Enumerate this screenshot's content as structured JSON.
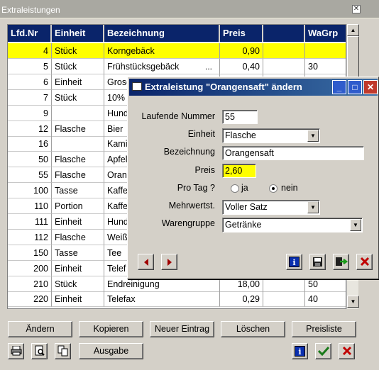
{
  "window": {
    "title": "Extraleistungen",
    "close_glyph": "✕"
  },
  "table": {
    "columns": [
      "Lfd.Nr",
      "Einheit",
      "Bezeichnung",
      "Preis",
      "",
      "WaGrp"
    ],
    "rows": [
      {
        "nr": "4",
        "einheit": "Stück",
        "bez": "Korngebäck",
        "preis": "0,90",
        "x": "",
        "wagrp": ""
      },
      {
        "nr": "5",
        "einheit": "Stück",
        "bez": "Frühstücksgebäck",
        "preis": "0,40",
        "x": "",
        "wagrp": "30",
        "ellipsis": "..."
      },
      {
        "nr": "6",
        "einheit": "Einheit",
        "bez": "Grosс",
        "preis": "",
        "x": "",
        "wagrp": ""
      },
      {
        "nr": "7",
        "einheit": "Stück",
        "bez": "10%",
        "preis": "",
        "x": "",
        "wagrp": ""
      },
      {
        "nr": "9",
        "einheit": "",
        "bez": "Hund",
        "preis": "",
        "x": "",
        "wagrp": ""
      },
      {
        "nr": "12",
        "einheit": "Flasche",
        "bez": "Bier",
        "preis": "",
        "x": "",
        "wagrp": ""
      },
      {
        "nr": "16",
        "einheit": "",
        "bez": "Kami",
        "preis": "",
        "x": "",
        "wagrp": ""
      },
      {
        "nr": "50",
        "einheit": "Flasche",
        "bez": "Apfel",
        "preis": "",
        "x": "",
        "wagrp": ""
      },
      {
        "nr": "55",
        "einheit": "Flasche",
        "bez": "Orang",
        "preis": "",
        "x": "",
        "wagrp": ""
      },
      {
        "nr": "100",
        "einheit": "Tasse",
        "bez": "Kaffe",
        "preis": "",
        "x": "",
        "wagrp": ""
      },
      {
        "nr": "110",
        "einheit": "Portion",
        "bez": "Kaffe",
        "preis": "",
        "x": "",
        "wagrp": ""
      },
      {
        "nr": "111",
        "einheit": "Einheit",
        "bez": "Hund",
        "preis": "",
        "x": "",
        "wagrp": ""
      },
      {
        "nr": "112",
        "einheit": "Flasche",
        "bez": "Weiß",
        "preis": "",
        "x": "",
        "wagrp": ""
      },
      {
        "nr": "150",
        "einheit": "Tasse",
        "bez": "Tee",
        "preis": "",
        "x": "",
        "wagrp": ""
      },
      {
        "nr": "200",
        "einheit": "Einheit",
        "bez": "Telef",
        "preis": "",
        "x": "",
        "wagrp": ""
      },
      {
        "nr": "210",
        "einheit": "Stück",
        "bez": "Endreinigung",
        "preis": "18,00",
        "x": "",
        "wagrp": "50"
      },
      {
        "nr": "220",
        "einheit": "Einheit",
        "bez": "Telefax",
        "preis": "0,29",
        "x": "",
        "wagrp": "40"
      }
    ]
  },
  "buttons": {
    "aendern": "Ändern",
    "kopieren": "Kopieren",
    "neuer_eintrag": "Neuer Eintrag",
    "loeschen": "Löschen",
    "preisliste": "Preisliste",
    "ausgabe": "Ausgabe"
  },
  "dialog": {
    "title": "Extraleistung \"Orangensaft\" ändern",
    "labels": {
      "lfd_nr": "Laufende Nummer",
      "einheit": "Einheit",
      "bezeichnung": "Bezeichnung",
      "preis": "Preis",
      "pro_tag": "Pro Tag ?",
      "mwst": "Mehrwertst.",
      "warengruppe": "Warengruppe"
    },
    "values": {
      "lfd_nr": "55",
      "einheit": "Flasche",
      "bezeichnung": "Orangensaft",
      "preis": "2,60",
      "mwst": "Voller Satz",
      "warengruppe": "Getränke"
    },
    "radio": {
      "ja": "ja",
      "nein": "nein",
      "selected": "nein"
    }
  },
  "colors": {
    "header": "#0a246a",
    "selection": "#ffff00",
    "dialog_title": "#0a246a"
  }
}
